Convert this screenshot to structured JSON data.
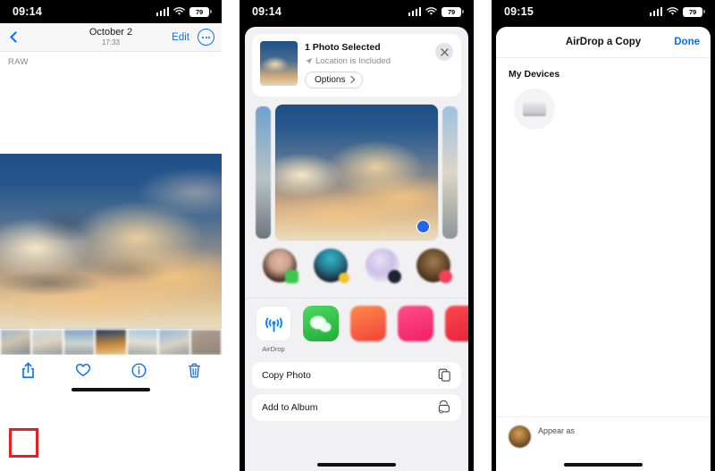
{
  "panels": [
    {
      "id": "photo-viewer",
      "status_bar": {
        "time": "09:14",
        "battery": "79",
        "signal_icon": "cellular-bars-icon",
        "wifi_icon": "wifi-icon",
        "battery_icon": "battery-icon"
      },
      "nav": {
        "back_icon": "chevron-left-icon",
        "date": "October 2",
        "time": "17:33",
        "edit_label": "Edit",
        "more_icon": "ellipsis-circle-icon"
      },
      "raw_badge": "RAW",
      "toolbar": {
        "share_icon": "share-icon",
        "favorite_icon": "heart-icon",
        "info_icon": "info-circle-icon",
        "delete_icon": "trash-icon"
      }
    },
    {
      "id": "share-sheet",
      "status_bar": {
        "time": "09:14",
        "battery": "79"
      },
      "header": {
        "title": "1 Photo Selected",
        "subtitle": "Location is Included",
        "location_icon": "location-arrow-icon",
        "options_label": "Options",
        "options_chevron_icon": "chevron-right-icon",
        "close_icon": "close-icon"
      },
      "contacts": [
        {
          "name": "",
          "badge": "messages-badge"
        },
        {
          "name": "",
          "badge": "app-badge"
        },
        {
          "name": "",
          "badge": "app-badge"
        },
        {
          "name": "",
          "badge": "app-badge"
        }
      ],
      "apps": [
        {
          "label": "AirDrop",
          "icon": "airdrop-icon"
        },
        {
          "label": "",
          "icon": "green-app-icon"
        },
        {
          "label": "",
          "icon": "orange-app-icon"
        },
        {
          "label": "",
          "icon": "pink-app-icon"
        },
        {
          "label": "",
          "icon": "red-app-icon"
        }
      ],
      "actions": [
        {
          "label": "Copy Photo",
          "icon": "copy-icon"
        },
        {
          "label": "Add to Album",
          "icon": "add-to-album-icon"
        }
      ]
    },
    {
      "id": "airdrop-picker",
      "status_bar": {
        "time": "09:15",
        "battery": "79"
      },
      "header": {
        "title": "AirDrop a Copy",
        "done_label": "Done"
      },
      "devices_section_title": "My Devices",
      "devices": [
        {
          "name": "",
          "icon": "mac-studio-icon"
        }
      ],
      "appear_as": {
        "label": "Appear as",
        "value": ""
      }
    }
  ],
  "highlights": [
    {
      "name": "share-button-highlight",
      "color": "#ec1c24"
    },
    {
      "name": "airdrop-app-highlight",
      "color": "#ec1c24"
    },
    {
      "name": "my-devices-highlight",
      "color": "#ec1c24"
    }
  ]
}
